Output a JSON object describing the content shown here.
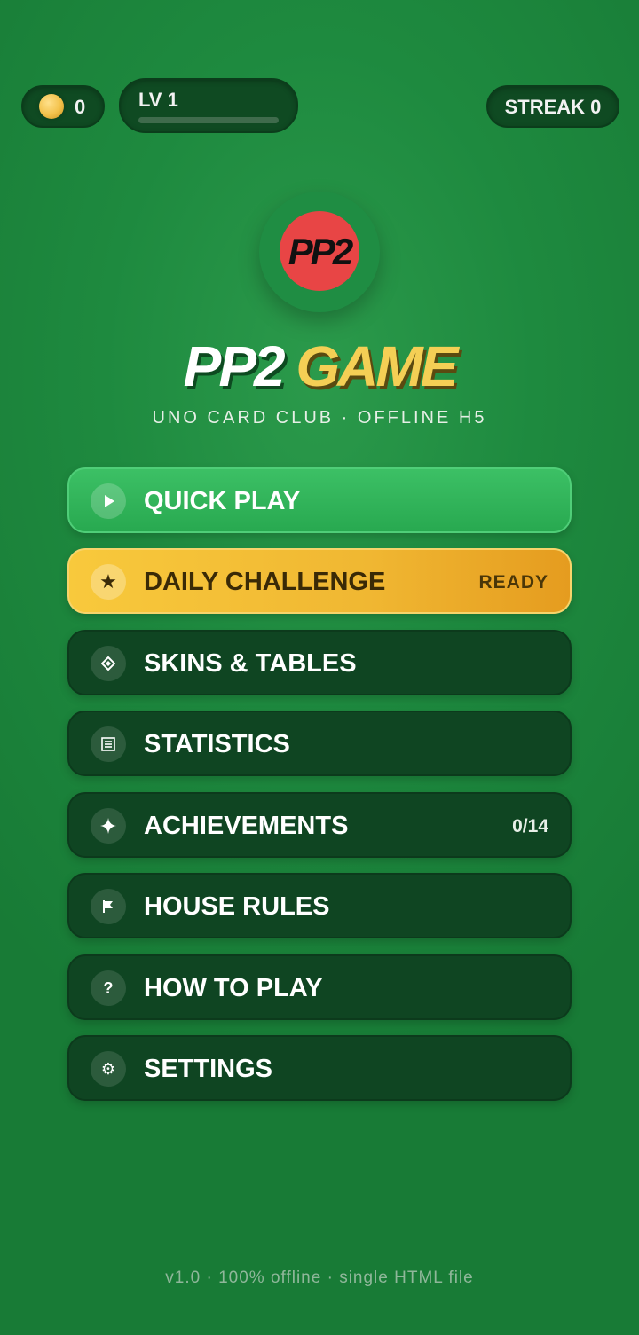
{
  "hud": {
    "coins": "0",
    "level": "LV 1",
    "xp_progress": 0,
    "streak": "STREAK 0"
  },
  "logo": {
    "badge_text": "PP2"
  },
  "title": {
    "part1": "PP2",
    "part2": "GAME"
  },
  "subtitle": "UNO CARD CLUB · OFFLINE H5",
  "menu": {
    "items": [
      {
        "label": "QUICK PLAY",
        "icon": "play-icon",
        "badge": ""
      },
      {
        "label": "DAILY CHALLENGE",
        "icon": "star-icon",
        "badge": "READY"
      },
      {
        "label": "SKINS & TABLES",
        "icon": "diamond-icon",
        "badge": ""
      },
      {
        "label": "STATISTICS",
        "icon": "list-icon",
        "badge": ""
      },
      {
        "label": "ACHIEVEMENTS",
        "icon": "sparkle-icon",
        "badge": "0/14"
      },
      {
        "label": "HOUSE RULES",
        "icon": "flag-icon",
        "badge": ""
      },
      {
        "label": "HOW TO PLAY",
        "icon": "question-icon",
        "badge": ""
      },
      {
        "label": "SETTINGS",
        "icon": "gear-icon",
        "badge": ""
      }
    ]
  },
  "footer": "v1.0 · 100% offline · single HTML file"
}
